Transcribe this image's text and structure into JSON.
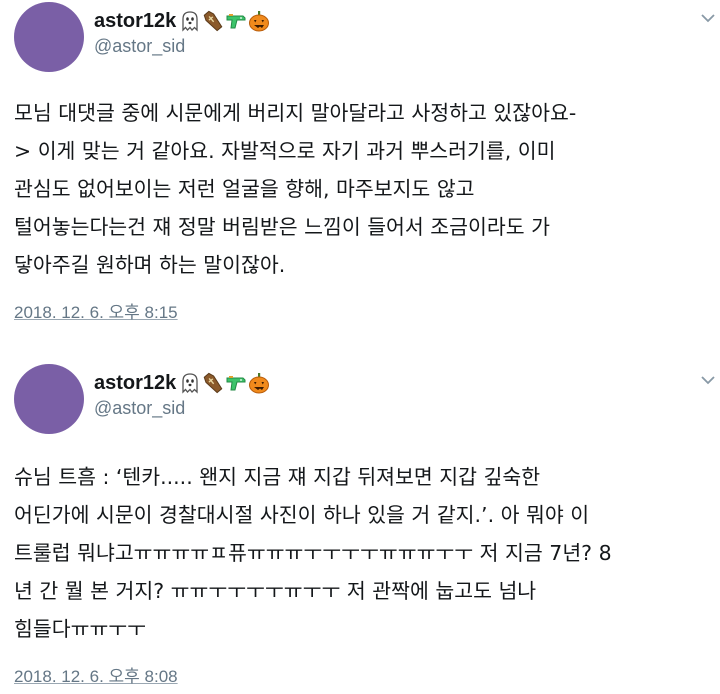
{
  "tweets": [
    {
      "display_name": "astor12k",
      "handle": "@astor_sid",
      "badges": [
        "ghost-icon",
        "coffin-icon",
        "water-pistol-icon",
        "jack-o-lantern-icon"
      ],
      "lines": [
        "모님 대댓글 중에 시문에게 버리지 말아달라고 사정하고 있잖아요-",
        "> 이게 맞는 거 같아요. 자발적으로 자기 과거 뿌스러기를, 이미",
        "관심도 없어보이는 저런 얼굴을 향해, 마주보지도 않고",
        "털어놓는다는건 쟤 정말 버림받은 느낌이 들어서 조금이라도 가",
        "닿아주길 원하며 하는 말이잖아."
      ],
      "timestamp": "2018. 12. 6. 오후 8:15"
    },
    {
      "display_name": "astor12k",
      "handle": "@astor_sid",
      "badges": [
        "ghost-icon",
        "coffin-icon",
        "water-pistol-icon",
        "jack-o-lantern-icon"
      ],
      "lines": [
        "슈님 트흠 : ‘텐카..... 왠지 지금 쟤 지갑 뒤져보면 지갑 깊숙한",
        "어딘가에 시문이 경찰대시절 사진이 하나 있을 거 같지.’. 아 뭐야 이",
        "트룰럽 뭐냐고ㅠㅠㅠㅠㅍ퓨ㅠㅠㅠㅜㅜㅜㅜㅠㅠㅠㅜㅜ 저 지금 7년? 8",
        "년 간 뭘 본 거지? ㅠㅠㅜㅜㅜㅜㅠㅜㅜ 저 관짝에 눕고도 넘나",
        "힘들다ㅠㅠㅜㅜ"
      ],
      "timestamp": "2018. 12. 6. 오후 8:08"
    }
  ]
}
